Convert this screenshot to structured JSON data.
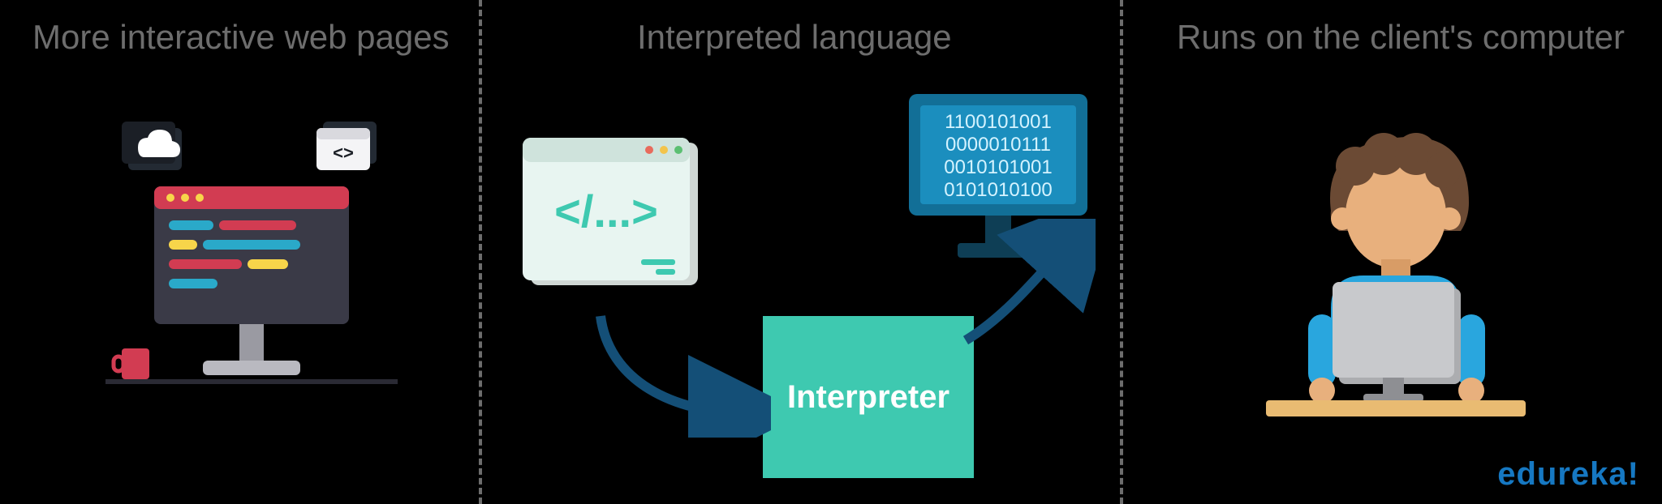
{
  "panels": {
    "left_title": "More interactive web pages",
    "center_title": "Interpreted language",
    "right_title": "Runs on the client's computer"
  },
  "interpreter_label": "Interpreter",
  "binary_lines": [
    "1100101001",
    "0000010111",
    "0010101001",
    "0101010100"
  ],
  "brand": "edureka!",
  "colors": {
    "title_grey": "#6d6d6d",
    "interpreter_box": "#3ec9b0",
    "interpreter_text": "#ffffff",
    "arrow": "#144f77",
    "monitor_blue": "#126f97",
    "monitor_screen": "#1b8ebe",
    "binary_text": "#d4f3ff",
    "code_window_bg": "#e8f5f1",
    "code_window_bar": "#cfe3dc",
    "code_brackets": "#3ec9b0",
    "desk_monitor_body": "#3a3a47",
    "desk_monitor_bar": "#d23c52",
    "person_skin": "#e8b07d",
    "person_hair": "#6b4a34",
    "person_shirt": "#29a6de",
    "client_monitor": "#c8c9cc",
    "client_monitor_back": "#acadb0",
    "desk_wood": "#e9bb72",
    "brand_blue": "#1678c2"
  }
}
